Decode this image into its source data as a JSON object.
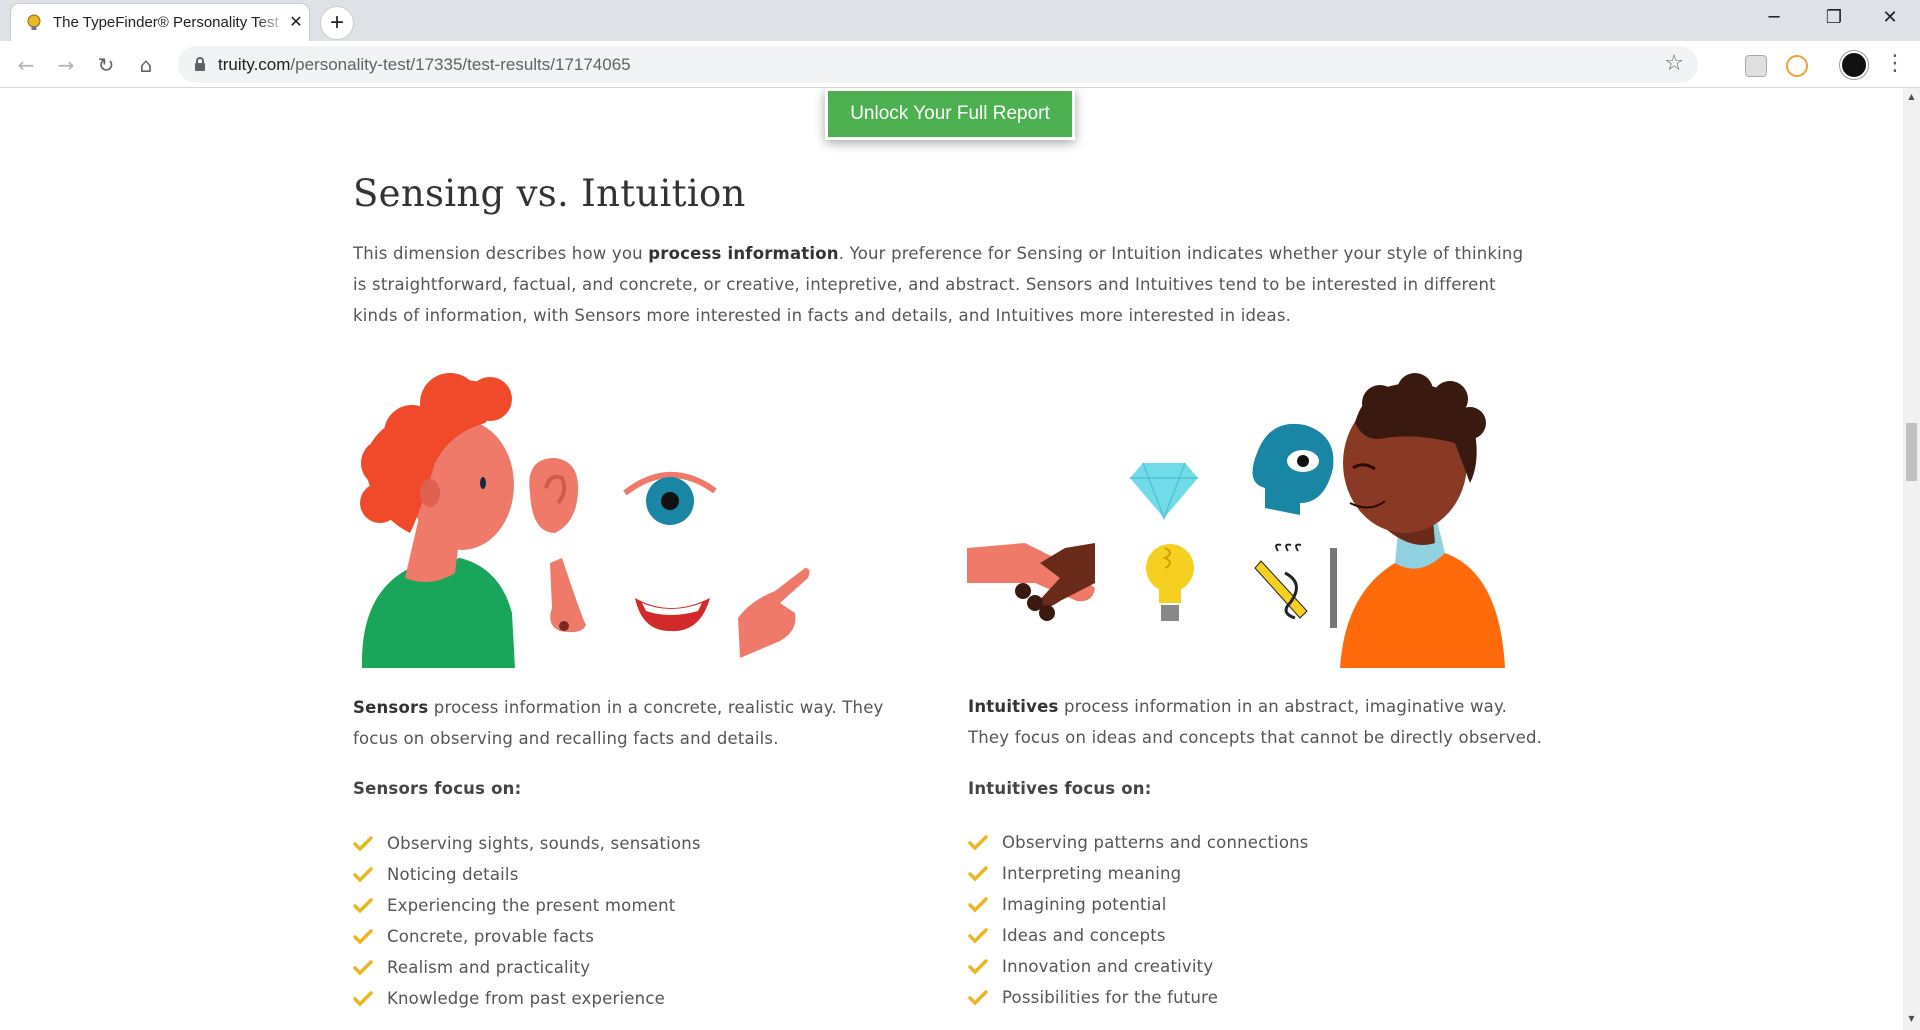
{
  "browser": {
    "tab_title": "The TypeFinder® Personality Test",
    "tab_close": "✕",
    "new_tab": "+",
    "url_host": "truity.com",
    "url_path": "/personality-test/17335/test-results/17174065",
    "window_controls": {
      "minimize": "─",
      "restore": "❐",
      "close": "✕"
    },
    "nav": {
      "back": "←",
      "forward": "→",
      "reload": "↻",
      "home": "⌂"
    },
    "menu": "⋮",
    "star": "☆"
  },
  "page": {
    "unlock_button": "Unlock Your Full Report",
    "section_title": "Sensing vs. Intuition",
    "intro_before": "This dimension describes how you ",
    "intro_bold": "process information",
    "intro_after": ". Your preference for Sensing or Intuition indicates whether your style of thinking is straightforward, factual, and concrete, or creative, intepretive, and abstract. Sensors and Intuitives tend to be interested in different kinds of information, with Sensors more interested in facts and details, and Intuitives more interested in ideas.",
    "sensors": {
      "lead_bold": "Sensors",
      "lead_text": " process information in a concrete, realistic way. They focus on observing and recalling facts and details.",
      "focus_heading": "Sensors focus on:",
      "items": [
        "Observing sights, sounds, sensations",
        "Noticing details",
        "Experiencing the present moment",
        "Concrete, provable facts",
        "Realism and practicality",
        "Knowledge from past experience"
      ]
    },
    "intuitives": {
      "lead_bold": "Intuitives",
      "lead_text": " process information in an abstract, imaginative way. They focus on ideas and concepts that cannot be directly observed.",
      "focus_heading": "Intuitives focus on:",
      "items": [
        "Observing patterns and connections",
        "Interpreting meaning",
        "Imagining potential",
        "Ideas and concepts",
        "Innovation and creativity",
        "Possibilities for the future"
      ]
    },
    "colors": {
      "accent_green": "#4caf50",
      "check_gold": "#e8b923"
    }
  }
}
